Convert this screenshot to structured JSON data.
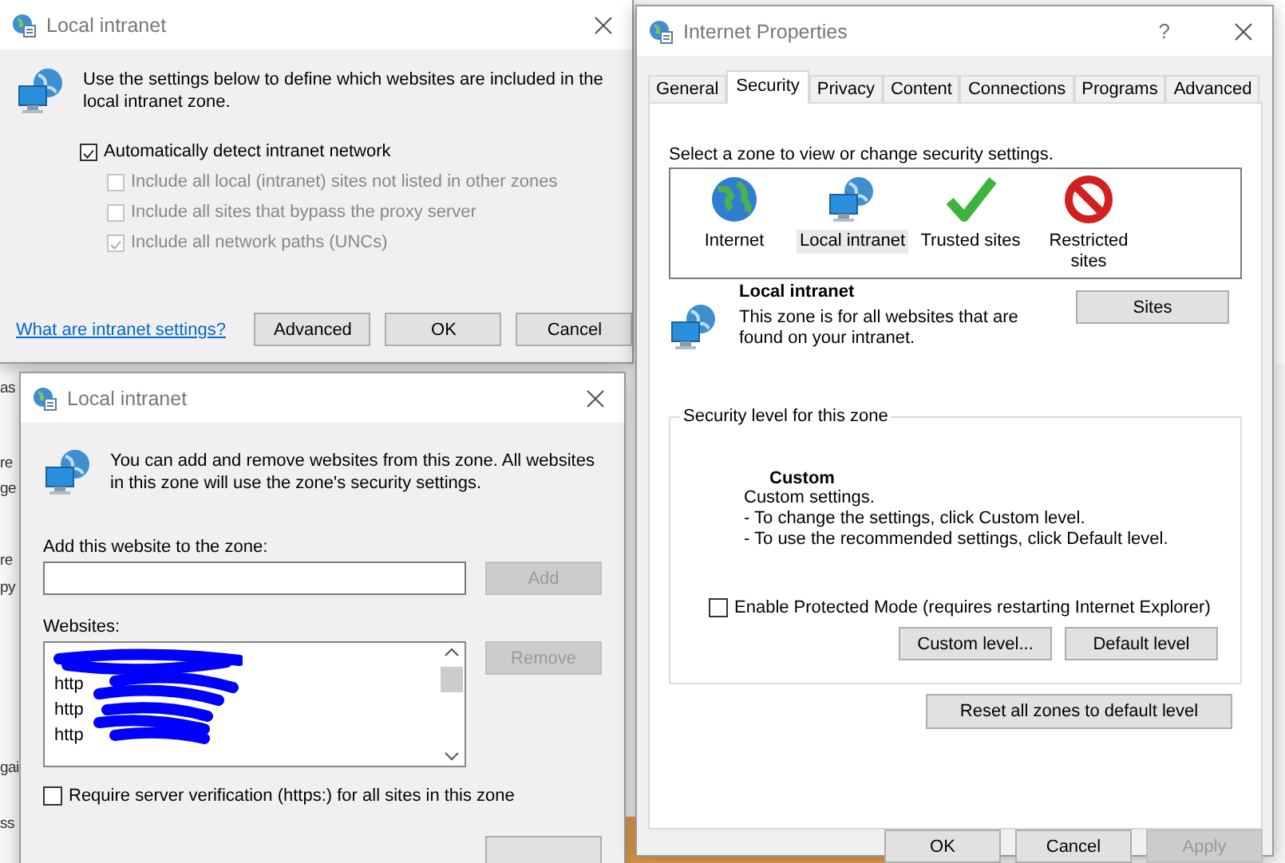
{
  "background": {
    "fragments": [
      "as",
      "re",
      "ge",
      "re",
      "py",
      "gai",
      "ss"
    ]
  },
  "intranet_dialog": {
    "title": "Local intranet",
    "description": "Use the settings below to define which websites are included in the local intranet zone.",
    "checkboxes": [
      {
        "label": "Automatically detect intranet network",
        "checked": true,
        "disabled": false,
        "kind": "main"
      },
      {
        "label": "Include all local (intranet) sites not listed in other zones",
        "checked": false,
        "disabled": true,
        "kind": "sub"
      },
      {
        "label": "Include all sites that bypass the proxy server",
        "checked": false,
        "disabled": true,
        "kind": "sub"
      },
      {
        "label": "Include all network paths (UNCs)",
        "checked": true,
        "disabled": true,
        "kind": "sub"
      }
    ],
    "link": "What are intranet settings?",
    "buttons": [
      {
        "label": "Advanced"
      },
      {
        "label": "OK"
      },
      {
        "label": "Cancel"
      }
    ]
  },
  "sites_dialog": {
    "title": "Local intranet",
    "description": "You can add and remove websites from this zone. All websites in this zone will use the zone's security settings.",
    "add_label": "Add this website to the zone:",
    "add_button": {
      "label": "Add",
      "disabled": true
    },
    "websites_label": "Websites:",
    "websites": [
      "http",
      "http",
      "http"
    ],
    "remove_button": {
      "label": "Remove",
      "disabled": true
    },
    "require_https": {
      "label": "Require server verification (https:) for all sites in this zone",
      "checked": false
    }
  },
  "properties": {
    "title": "Internet Properties",
    "help": "?",
    "tabs": [
      {
        "label": "General",
        "selected": false
      },
      {
        "label": "Security",
        "selected": true
      },
      {
        "label": "Privacy",
        "selected": false
      },
      {
        "label": "Content",
        "selected": false
      },
      {
        "label": "Connections",
        "selected": false
      },
      {
        "label": "Programs",
        "selected": false
      },
      {
        "label": "Advanced",
        "selected": false
      }
    ],
    "zone_prompt": "Select a zone to view or change security settings.",
    "zones": [
      {
        "name": "Internet",
        "kind": "internet",
        "selected": false
      },
      {
        "name": "Local intranet",
        "kind": "intranet",
        "selected": true
      },
      {
        "name": "Trusted sites",
        "kind": "trusted",
        "selected": false
      },
      {
        "name": "Restricted sites",
        "kind": "restricted",
        "selected": false
      }
    ],
    "zone_title": "Local intranet",
    "zone_description": "This zone is for all websites that are found on your intranet.",
    "sites_button": "Sites",
    "level_legend": "Security level for this zone",
    "level_title": "Custom",
    "level_lines": [
      "Custom settings.",
      "- To change the settings, click Custom level.",
      "- To use the recommended settings, click Default level."
    ],
    "protected_mode": {
      "label": "Enable Protected Mode (requires restarting Internet Explorer)",
      "checked": false
    },
    "level_buttons": [
      {
        "label": "Custom level..."
      },
      {
        "label": "Default level"
      }
    ],
    "reset_button": "Reset all zones to default level",
    "buttons": [
      {
        "label": "OK",
        "disabled": false
      },
      {
        "label": "Cancel",
        "disabled": false
      },
      {
        "label": "Apply",
        "disabled": true
      }
    ]
  }
}
